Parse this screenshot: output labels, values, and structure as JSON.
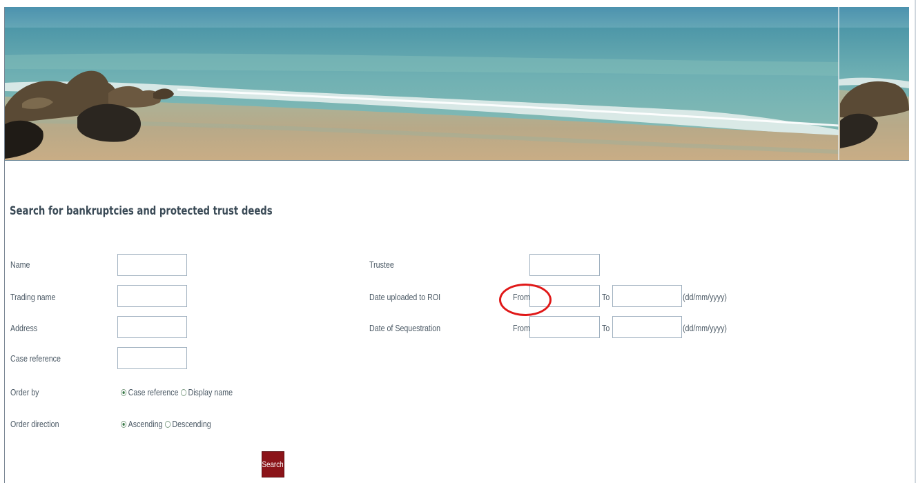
{
  "page": {
    "title": "Search for bankruptcies and protected trust deeds"
  },
  "form_left": {
    "name_label": "Name",
    "trading_name_label": "Trading name",
    "address_label": "Address",
    "case_reference_label": "Case reference",
    "order_by_label": "Order by",
    "order_by_options": [
      "Case reference",
      "Display name"
    ],
    "order_by_selected": "Case reference",
    "order_direction_label": "Order direction",
    "order_direction_options": [
      "Ascending",
      "Descending"
    ],
    "order_direction_selected": "Ascending"
  },
  "form_right": {
    "trustee_label": "Trustee",
    "date_uploaded_label": "Date uploaded to ROI",
    "date_sequestration_label": "Date of Sequestration",
    "from_label": "From",
    "to_label": "To",
    "date_format_hint": "(dd/mm/yyyy)"
  },
  "actions": {
    "search_label": "Search"
  },
  "colors": {
    "search_button": "#8b1419",
    "highlight": "#e01818",
    "title_text": "#3a4a56"
  }
}
